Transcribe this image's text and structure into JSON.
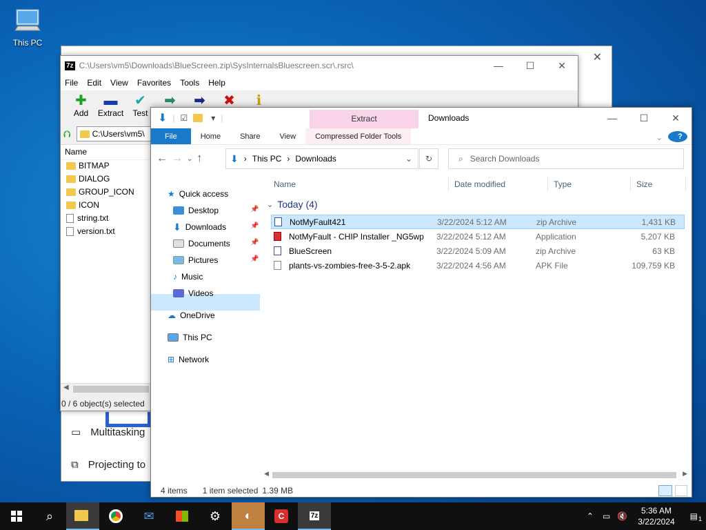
{
  "desktop": {
    "icon_label": "This PC"
  },
  "settings": {
    "items": [
      {
        "label": "Multitasking"
      },
      {
        "label": "Projecting to"
      }
    ]
  },
  "sevenzip": {
    "title": "C:\\Users\\vm5\\Downloads\\BlueScreen.zip\\SysInternalsBluescreen.scr\\.rsrc\\",
    "badge": "7z",
    "menu": [
      "File",
      "Edit",
      "View",
      "Favorites",
      "Tools",
      "Help"
    ],
    "toolbar": [
      {
        "label": "Add",
        "icon": "plus-icon",
        "color": "#18a018"
      },
      {
        "label": "Extract",
        "icon": "minus-icon",
        "color": "#1a3aa8"
      },
      {
        "label": "Test",
        "icon": "check-icon",
        "color": "#18a8a8"
      },
      {
        "label": "Copy",
        "icon": "arrow-icon",
        "color": "#2a8a6a"
      },
      {
        "label": "Move",
        "icon": "arrow-icon",
        "color": "#1a2a8a"
      },
      {
        "label": "Delete",
        "icon": "x-icon",
        "color": "#d01010"
      },
      {
        "label": "Info",
        "icon": "info-icon",
        "color": "#c8a010"
      }
    ],
    "address": "C:\\Users\\vm5\\",
    "list_header": "Name",
    "files": [
      {
        "name": "BITMAP",
        "kind": "folder"
      },
      {
        "name": "DIALOG",
        "kind": "folder"
      },
      {
        "name": "GROUP_ICON",
        "kind": "folder"
      },
      {
        "name": "ICON",
        "kind": "folder"
      },
      {
        "name": "string.txt",
        "kind": "file"
      },
      {
        "name": "version.txt",
        "kind": "file"
      }
    ],
    "status": "0 / 6 object(s) selected"
  },
  "explorer": {
    "title": "Downloads",
    "context_tab": "Extract",
    "ribbon": {
      "file": "File",
      "home": "Home",
      "share": "Share",
      "view": "View",
      "tools": "Compressed Folder Tools",
      "help": "?"
    },
    "address": {
      "root": "This PC",
      "current": "Downloads"
    },
    "search_placeholder": "Search Downloads",
    "nav": {
      "quick_access": "Quick access",
      "desktop": "Desktop",
      "downloads": "Downloads",
      "documents": "Documents",
      "pictures": "Pictures",
      "music": "Music",
      "videos": "Videos",
      "onedrive": "OneDrive",
      "thispc": "This PC",
      "network": "Network"
    },
    "columns": {
      "name": "Name",
      "date": "Date modified",
      "type": "Type",
      "size": "Size"
    },
    "group_label": "Today (4)",
    "files": [
      {
        "name": "NotMyFault421",
        "date": "3/22/2024 5:12 AM",
        "type": "zip Archive",
        "size": "1,431 KB",
        "selected": true
      },
      {
        "name": "NotMyFault - CHIP Installer _NG5wp",
        "date": "3/22/2024 5:12 AM",
        "type": "Application",
        "size": "5,207 KB",
        "selected": false
      },
      {
        "name": "BlueScreen",
        "date": "3/22/2024 5:09 AM",
        "type": "zip Archive",
        "size": "63 KB",
        "selected": false
      },
      {
        "name": "plants-vs-zombies-free-3-5-2.apk",
        "date": "3/22/2024 4:56 AM",
        "type": "APK File",
        "size": "109,759 KB",
        "selected": false
      }
    ],
    "status": {
      "count": "4 items",
      "selected": "1 item selected",
      "size": "1.39 MB"
    }
  },
  "taskbar": {
    "time": "5:36 AM",
    "date": "3/22/2024",
    "notifications": "1"
  }
}
